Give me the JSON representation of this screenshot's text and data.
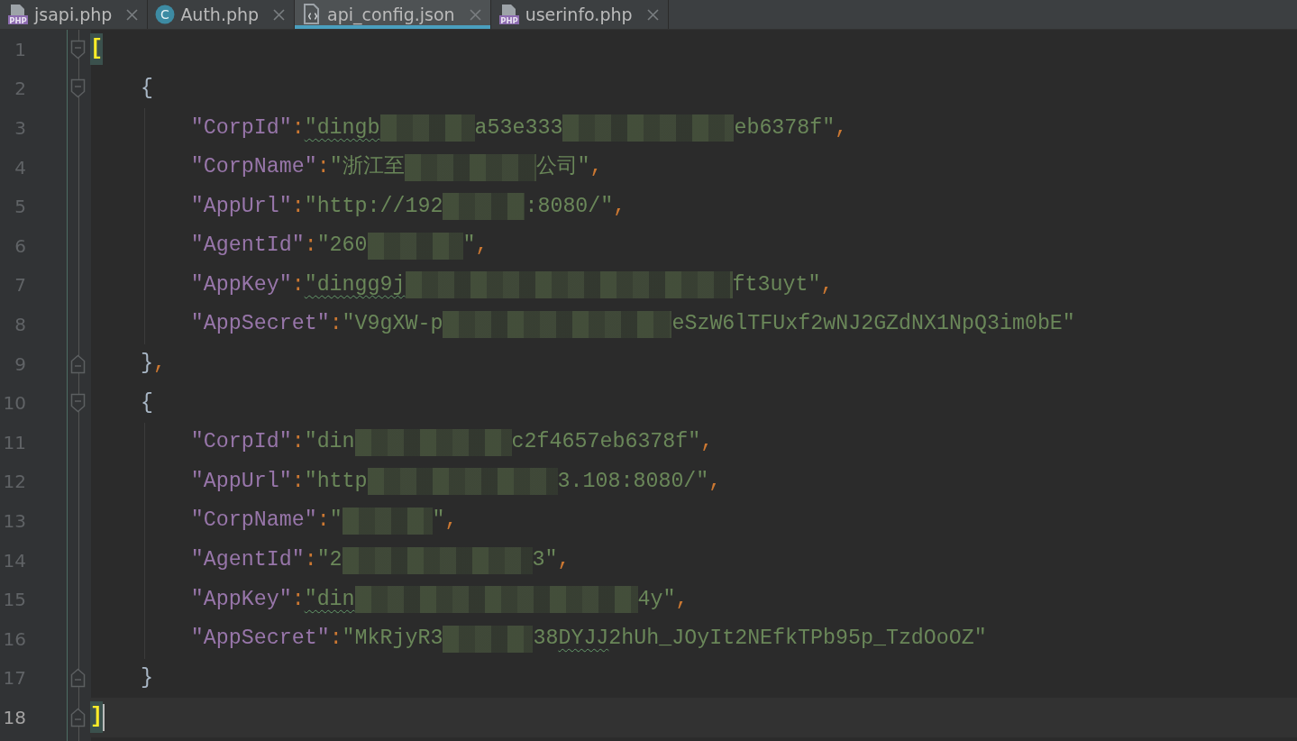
{
  "tabs": [
    {
      "label": "jsapi.php",
      "kind": "php",
      "icon_text": "PHP",
      "selected": false
    },
    {
      "label": "Auth.php",
      "kind": "class",
      "icon_text": "C",
      "selected": false
    },
    {
      "label": "api_config.json",
      "kind": "json",
      "selected": true
    },
    {
      "label": "userinfo.php",
      "kind": "php",
      "icon_text": "PHP",
      "selected": false
    }
  ],
  "lines": [
    {
      "number": "1",
      "kind": "fold_start",
      "tokens": [
        {
          "kind": "bracket",
          "text": "[",
          "matched": true
        }
      ],
      "children": [
        {
          "number": "2",
          "kind": "fold_start",
          "tokens": [
            {
              "kind": "brace",
              "text": "{"
            }
          ],
          "children": [
            {
              "number": "3",
              "tokens": [
                {
                  "kind": "key",
                  "text": "\"CorpId\""
                },
                {
                  "kind": "punct",
                  "text": ":"
                },
                {
                  "kind": "string",
                  "text": "\"dingb",
                  "typo": true
                },
                {
                  "kind": "redacted"
                },
                {
                  "kind": "string",
                  "text": "a53e333"
                },
                {
                  "kind": "redacted"
                },
                {
                  "kind": "string",
                  "text": "eb6378f\""
                },
                {
                  "kind": "punct",
                  "text": ","
                }
              ]
            },
            {
              "number": "4",
              "tokens": [
                {
                  "kind": "key",
                  "text": "\"CorpName\""
                },
                {
                  "kind": "punct",
                  "text": ":"
                },
                {
                  "kind": "string",
                  "text": "\"浙江至"
                },
                {
                  "kind": "redacted"
                },
                {
                  "kind": "string",
                  "text": "公司\""
                },
                {
                  "kind": "punct",
                  "text": ","
                }
              ]
            },
            {
              "number": "5",
              "tokens": [
                {
                  "kind": "key",
                  "text": "\"AppUrl\""
                },
                {
                  "kind": "punct",
                  "text": ":"
                },
                {
                  "kind": "string",
                  "text": "\"http://192"
                },
                {
                  "kind": "redacted"
                },
                {
                  "kind": "string",
                  "text": ":8080/\""
                },
                {
                  "kind": "punct",
                  "text": ","
                }
              ]
            },
            {
              "number": "6",
              "tokens": [
                {
                  "kind": "key",
                  "text": "\"AgentId\""
                },
                {
                  "kind": "punct",
                  "text": ":"
                },
                {
                  "kind": "string",
                  "text": "\"260"
                },
                {
                  "kind": "redacted"
                },
                {
                  "kind": "string",
                  "text": "\""
                },
                {
                  "kind": "punct",
                  "text": ","
                }
              ]
            },
            {
              "number": "7",
              "tokens": [
                {
                  "kind": "key",
                  "text": "\"AppKey\""
                },
                {
                  "kind": "punct",
                  "text": ":"
                },
                {
                  "kind": "string",
                  "text": "\"dingg9j",
                  "typo": true
                },
                {
                  "kind": "redacted"
                },
                {
                  "kind": "string",
                  "text": "ft3uyt\""
                },
                {
                  "kind": "punct",
                  "text": ","
                }
              ]
            },
            {
              "number": "8",
              "tokens": [
                {
                  "kind": "key",
                  "text": "\"AppSecret\""
                },
                {
                  "kind": "punct",
                  "text": ":"
                },
                {
                  "kind": "string",
                  "text": "\"V9gXW-p"
                },
                {
                  "kind": "redacted"
                },
                {
                  "kind": "string",
                  "text": "eSzW6lTFUxf2wNJ2GZdNX1NpQ3im0bE\""
                }
              ]
            }
          ]
        },
        {
          "number": "9",
          "kind": "fold_end",
          "tokens": [
            {
              "kind": "brace",
              "text": "}"
            },
            {
              "kind": "punct",
              "text": ","
            }
          ]
        },
        {
          "number": "10",
          "kind": "fold_start",
          "tokens": [
            {
              "kind": "brace",
              "text": "{"
            }
          ],
          "children": [
            {
              "number": "11",
              "tokens": [
                {
                  "kind": "key",
                  "text": "\"CorpId\""
                },
                {
                  "kind": "punct",
                  "text": ":"
                },
                {
                  "kind": "string",
                  "text": "\"din"
                },
                {
                  "kind": "redacted"
                },
                {
                  "kind": "string",
                  "text": "c2f4657eb6378f\""
                },
                {
                  "kind": "punct",
                  "text": ","
                }
              ]
            },
            {
              "number": "12",
              "tokens": [
                {
                  "kind": "key",
                  "text": "\"AppUrl\""
                },
                {
                  "kind": "punct",
                  "text": ":"
                },
                {
                  "kind": "string",
                  "text": "\"http"
                },
                {
                  "kind": "redacted"
                },
                {
                  "kind": "string",
                  "text": "3.108:8080/\""
                },
                {
                  "kind": "punct",
                  "text": ","
                }
              ]
            },
            {
              "number": "13",
              "tokens": [
                {
                  "kind": "key",
                  "text": "\"CorpName\""
                },
                {
                  "kind": "punct",
                  "text": ":"
                },
                {
                  "kind": "string",
                  "text": "\""
                },
                {
                  "kind": "redacted"
                },
                {
                  "kind": "string",
                  "text": "\""
                },
                {
                  "kind": "punct",
                  "text": ","
                }
              ]
            },
            {
              "number": "14",
              "tokens": [
                {
                  "kind": "key",
                  "text": "\"AgentId\""
                },
                {
                  "kind": "punct",
                  "text": ":"
                },
                {
                  "kind": "string",
                  "text": "\"2"
                },
                {
                  "kind": "redacted"
                },
                {
                  "kind": "string",
                  "text": "3\""
                },
                {
                  "kind": "punct",
                  "text": ","
                }
              ]
            },
            {
              "number": "15",
              "tokens": [
                {
                  "kind": "key",
                  "text": "\"AppKey\""
                },
                {
                  "kind": "punct",
                  "text": ":"
                },
                {
                  "kind": "string",
                  "text": "\"din",
                  "typo": true
                },
                {
                  "kind": "redacted"
                },
                {
                  "kind": "string",
                  "text": "4y\""
                },
                {
                  "kind": "punct",
                  "text": ","
                }
              ]
            },
            {
              "number": "16",
              "tokens": [
                {
                  "kind": "key",
                  "text": "\"AppSecret\""
                },
                {
                  "kind": "punct",
                  "text": ":"
                },
                {
                  "kind": "string",
                  "text": "\"MkRjyR3"
                },
                {
                  "kind": "redacted"
                },
                {
                  "kind": "string",
                  "text": "38"
                },
                {
                  "kind": "string",
                  "text": "DYJJ",
                  "typo": true
                },
                {
                  "kind": "string",
                  "text": "2hUh_JOyIt2NEfkTPb95p_TzdOoOZ\""
                }
              ]
            }
          ]
        },
        {
          "number": "17",
          "kind": "fold_end",
          "tokens": [
            {
              "kind": "brace",
              "text": "}"
            }
          ]
        }
      ]
    },
    {
      "number": "18",
      "kind": "fold_end",
      "current": true,
      "tokens": [
        {
          "kind": "bracket",
          "text": "]",
          "matched": true
        }
      ]
    }
  ]
}
